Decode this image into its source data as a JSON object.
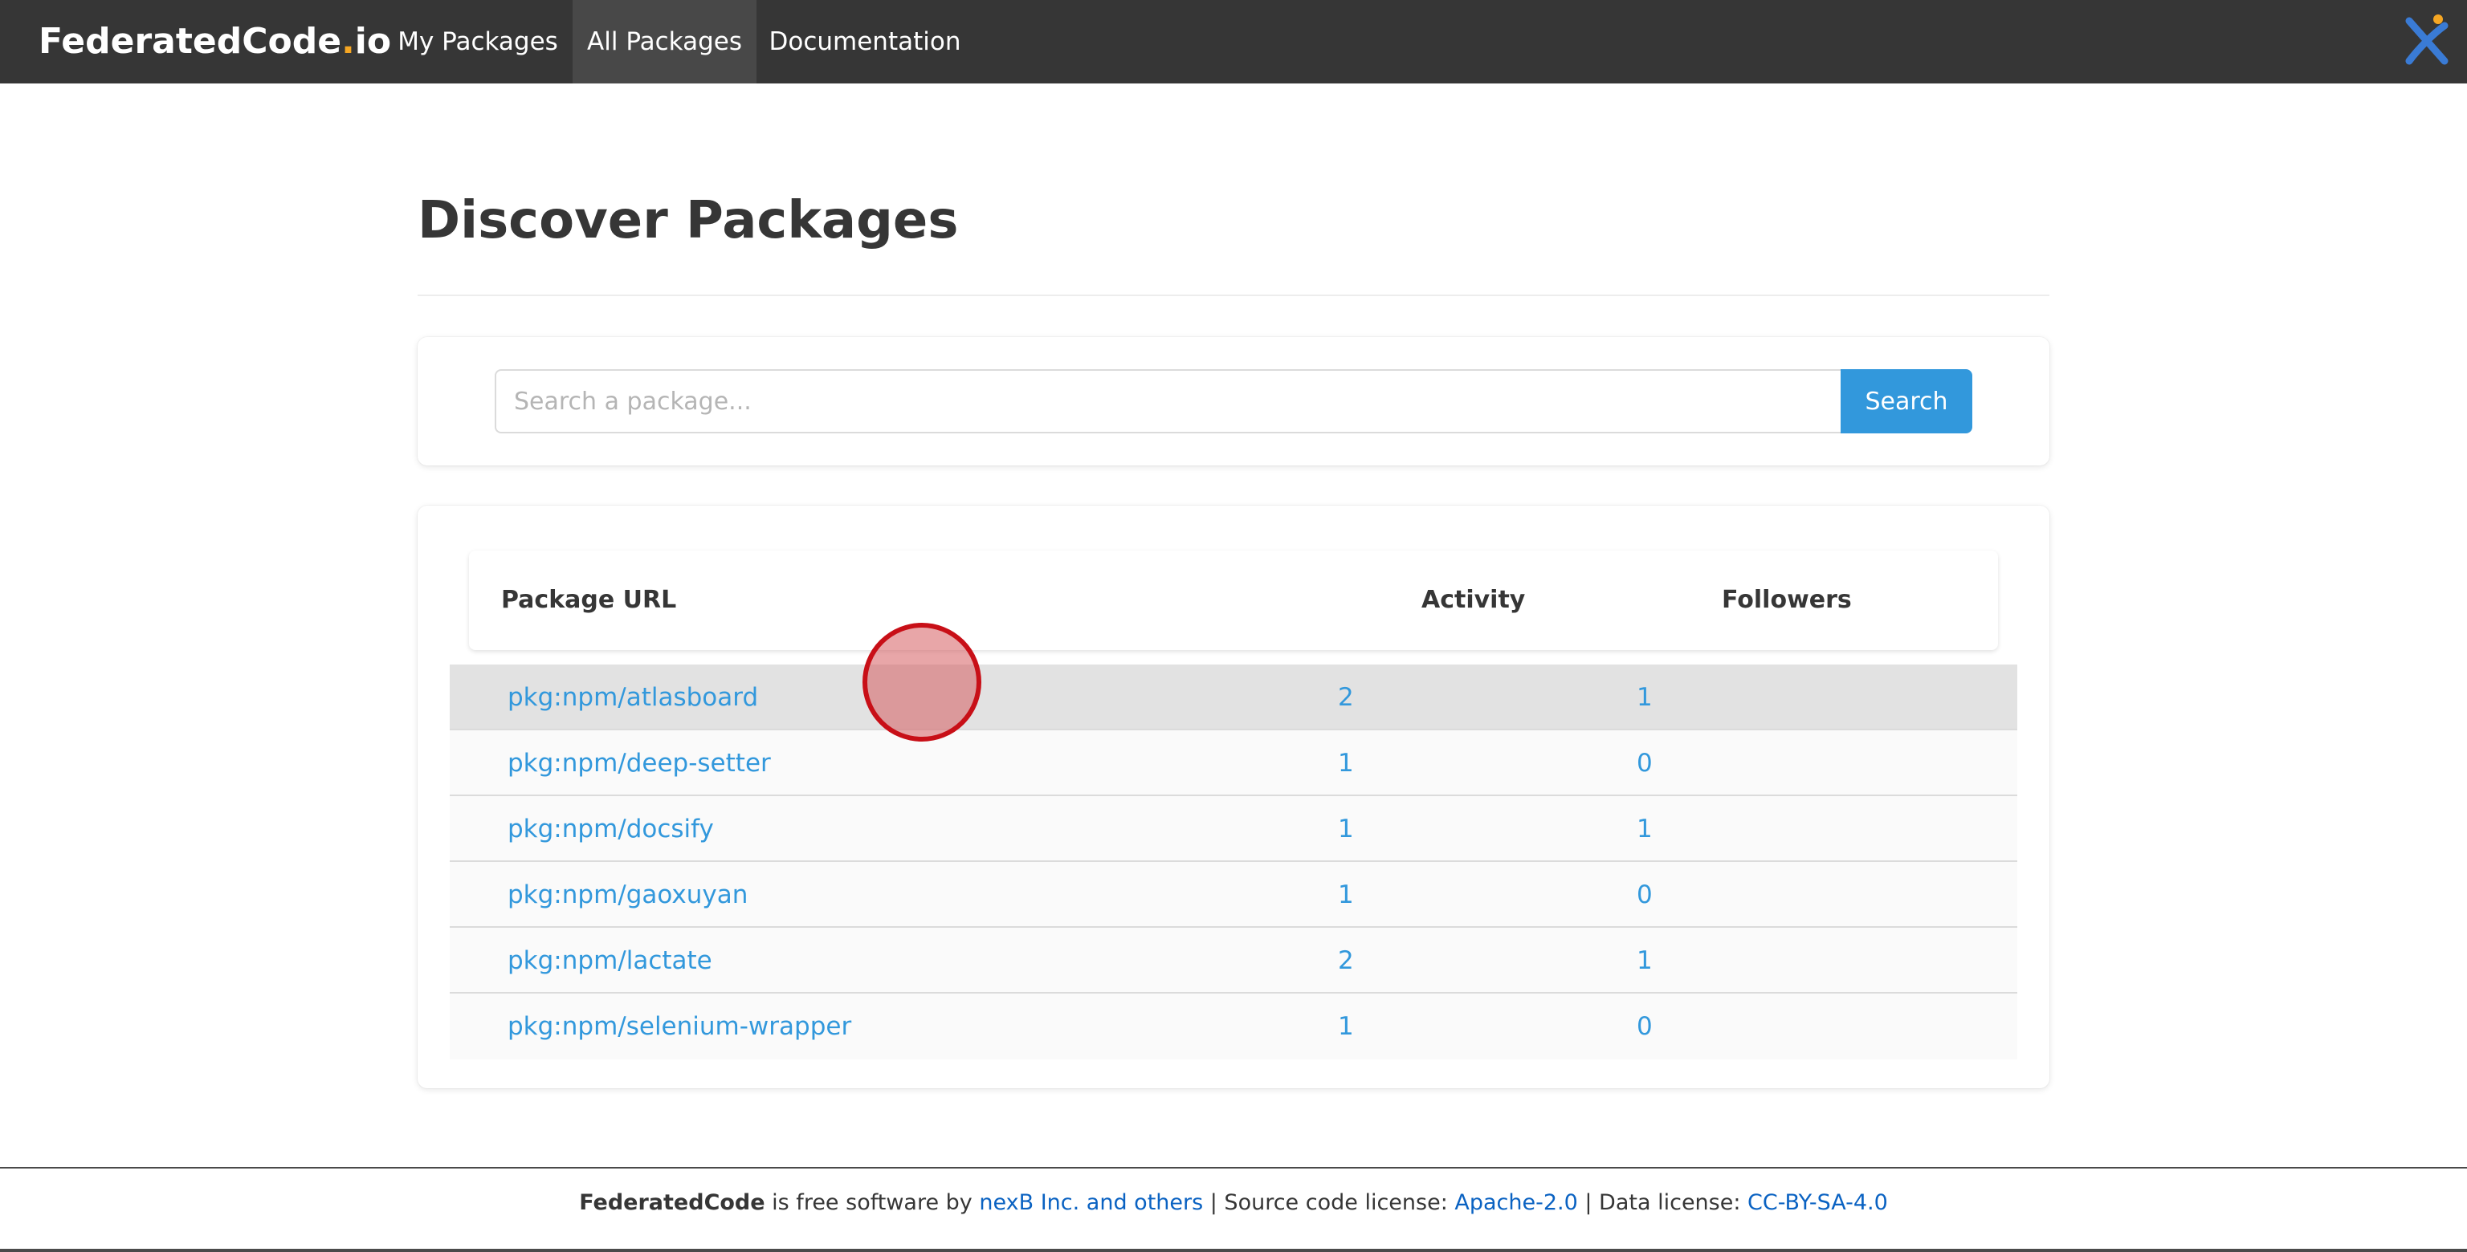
{
  "nav": {
    "brand_main": "FederatedCode",
    "brand_dot": ".",
    "brand_tld": "io",
    "items": [
      {
        "label": "My Packages",
        "active": false
      },
      {
        "label": "All Packages",
        "active": true
      },
      {
        "label": "Documentation",
        "active": false
      }
    ],
    "logo_icon": "aboutcode-x-logo-icon"
  },
  "main": {
    "title": "Discover Packages",
    "search": {
      "placeholder": "Search a package...",
      "value": "",
      "button_label": "Search"
    },
    "table": {
      "headers": [
        "Package URL",
        "Activity",
        "Followers"
      ],
      "rows": [
        {
          "purl": "pkg:npm/atlasboard",
          "activity": "2",
          "followers": "1"
        },
        {
          "purl": "pkg:npm/deep-setter",
          "activity": "1",
          "followers": "0"
        },
        {
          "purl": "pkg:npm/docsify",
          "activity": "1",
          "followers": "1"
        },
        {
          "purl": "pkg:npm/gaoxuyan",
          "activity": "1",
          "followers": "0"
        },
        {
          "purl": "pkg:npm/lactate",
          "activity": "2",
          "followers": "1"
        },
        {
          "purl": "pkg:npm/selenium-wrapper",
          "activity": "1",
          "followers": "0"
        }
      ]
    }
  },
  "footer": {
    "product": "FederatedCode",
    "text_1": " is free software by ",
    "link_authors": "nexB Inc. and others",
    "text_2": " | Source code license: ",
    "link_code_license": "Apache-2.0",
    "text_3": " | Data license: ",
    "link_data_license": "CC-BY-SA-4.0"
  },
  "colors": {
    "navbar": "#363636",
    "accent": "#3298dc",
    "footer_link": "#0a62c2",
    "cursor_marker": "#c80f17"
  }
}
